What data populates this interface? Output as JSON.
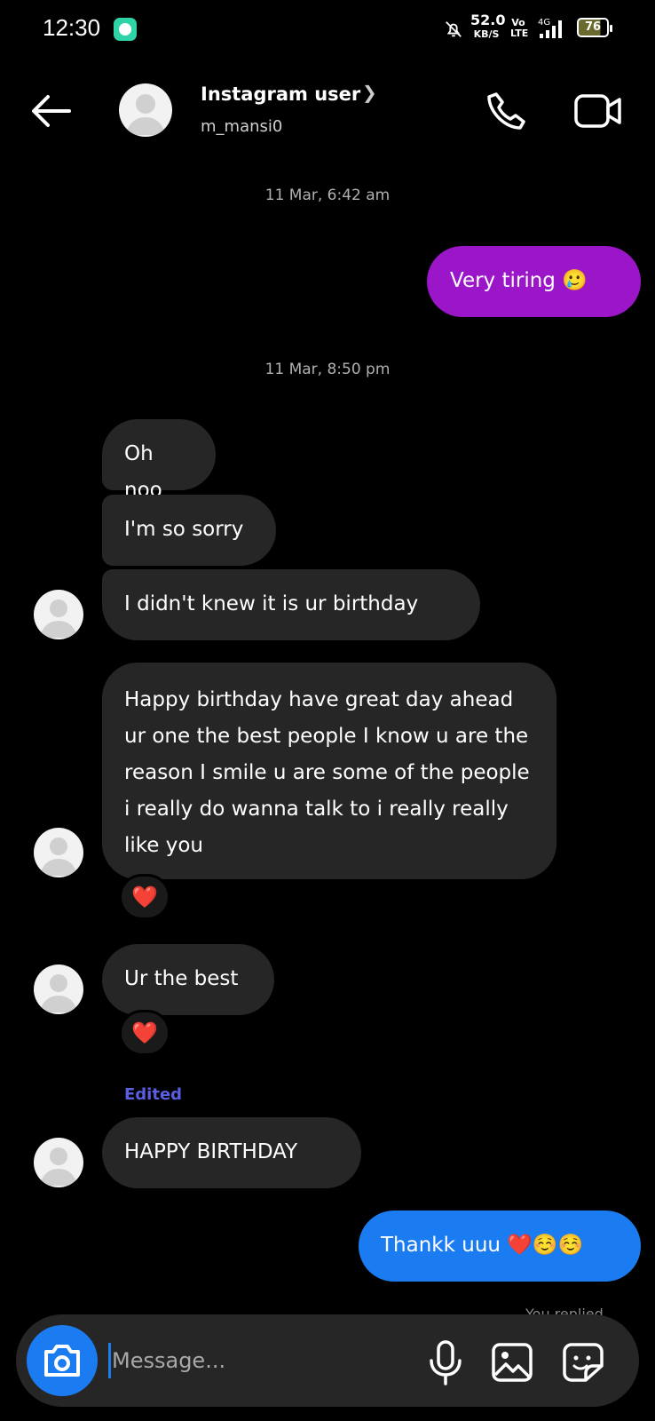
{
  "status_bar": {
    "time": "12:30",
    "net_speed": "52.0",
    "net_unit": "KB/S",
    "volte": "Vo LTE",
    "network": "4G",
    "battery": "76"
  },
  "header": {
    "name": "Instagram user",
    "username": "m_mansi0"
  },
  "conversation": {
    "timestamps": [
      "11 Mar, 6:42 am",
      "11 Mar, 8:50 pm"
    ],
    "messages": [
      {
        "from": "me",
        "text": "Very tiring 🥲"
      },
      {
        "from": "them",
        "text": "Oh noo"
      },
      {
        "from": "them",
        "text": "I'm so sorry"
      },
      {
        "from": "them",
        "text": "I didn't knew it is ur birthday"
      },
      {
        "from": "them",
        "text": "Happy birthday have great day ahead ur one the best people I know u are the reason I smile u are some of the people i really do wanna talk to i really really like you",
        "reaction": "❤️"
      },
      {
        "from": "them",
        "text": "Ur the best",
        "reaction": "❤️"
      },
      {
        "from": "them",
        "text": "HAPPY BIRTHDAY",
        "label": "Edited"
      },
      {
        "from": "me",
        "text": "Thankk uuu ❤️☺️☺️"
      }
    ],
    "reply_hint": "You replied"
  },
  "composer": {
    "placeholder": "Message..."
  },
  "colors": {
    "background": "#000000",
    "incoming_bubble": "#262626",
    "outgoing_purple": "#9b15c9",
    "outgoing_blue": "#1b7cf1",
    "edited_label": "#5a5ee0"
  },
  "icons": [
    "back-arrow-icon",
    "chevron-right-icon",
    "phone-icon",
    "video-camera-icon",
    "camera-icon",
    "microphone-icon",
    "gallery-icon",
    "sticker-icon",
    "heart-icon"
  ]
}
